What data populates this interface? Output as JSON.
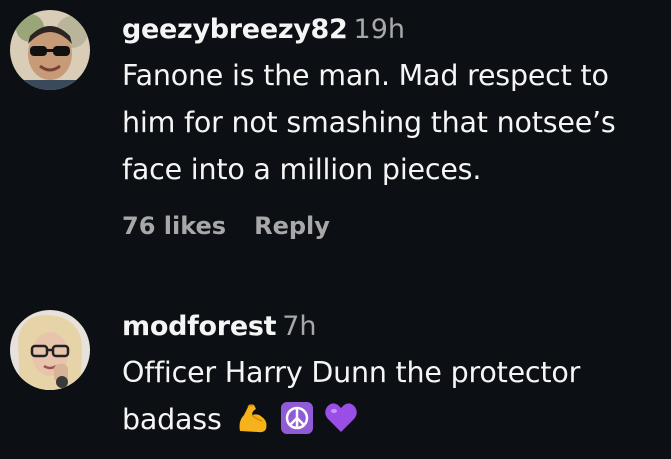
{
  "comments": [
    {
      "username": "geezybreezy82",
      "time": "19h",
      "text_lines": [
        "Fanone is the man. Mad respect to",
        "him for not smashing that notsee’s",
        "face into a million pieces."
      ],
      "likes": "76 likes",
      "reply": "Reply",
      "avatar": "avatar-man-sunglasses"
    },
    {
      "username": "modforest",
      "time": "7h",
      "text_lines": [
        "Officer Harry Dunn the protector",
        "badass"
      ],
      "emojis": [
        "flexed-biceps-emoji",
        "peace-symbol-emoji",
        "purple-heart-emoji"
      ],
      "avatar": "avatar-woman-glasses"
    }
  ],
  "colors": {
    "background": "#0c0f14",
    "primary_text": "#f5f5f5",
    "secondary_text": "#a8a8a8"
  }
}
